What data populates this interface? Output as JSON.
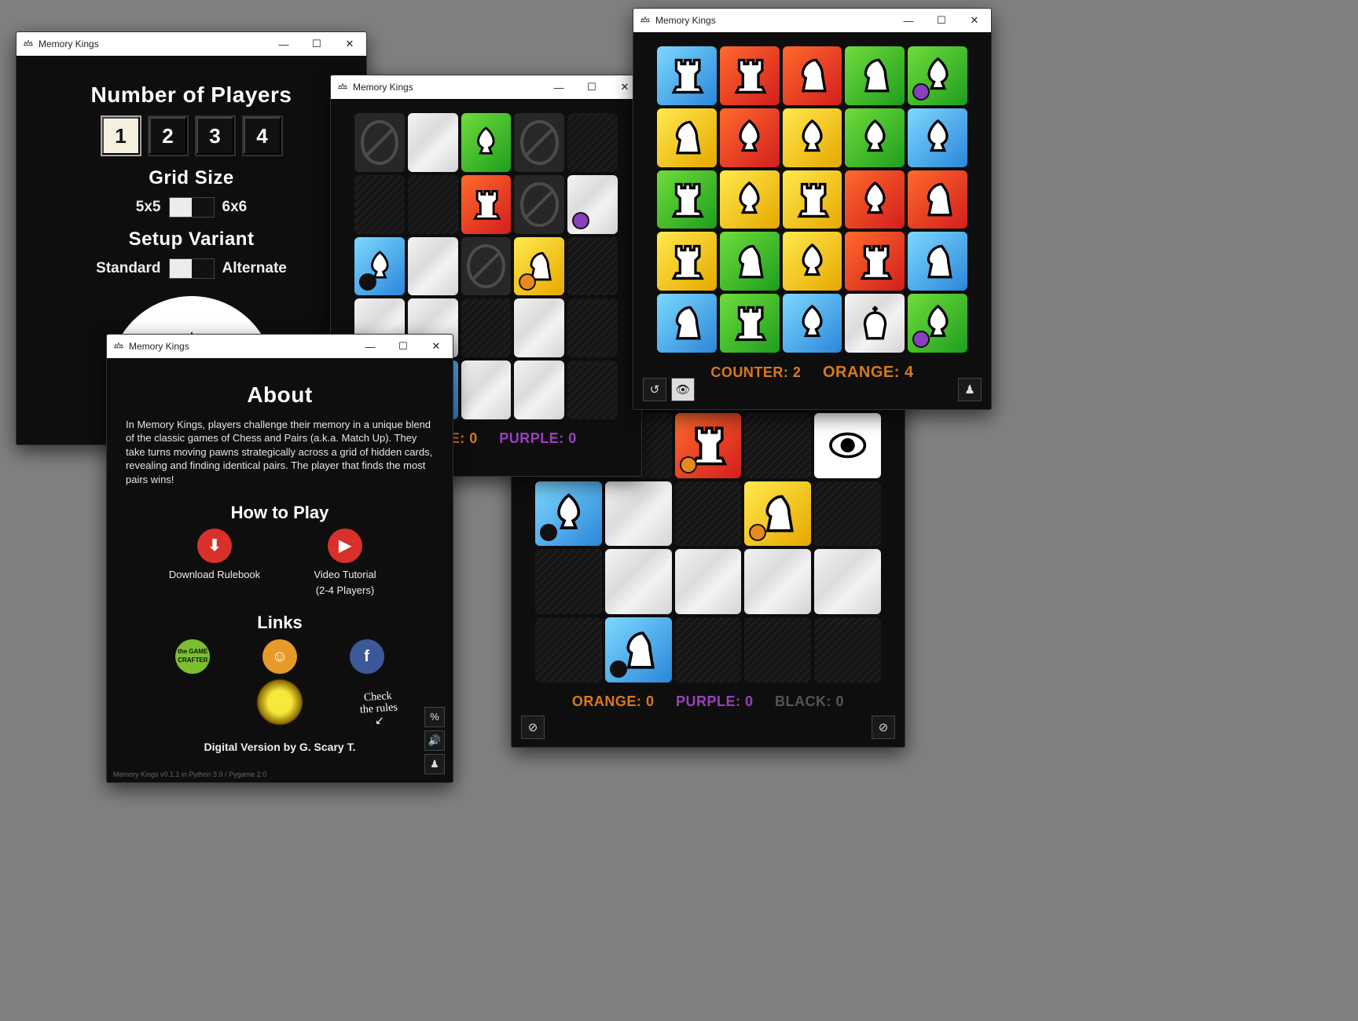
{
  "app_title": "Memory Kings",
  "settings": {
    "heading_players": "Number of Players",
    "players": [
      "1",
      "2",
      "3",
      "4"
    ],
    "selected_player": "1",
    "heading_grid": "Grid Size",
    "grid_left": "5x5",
    "grid_right": "6x6",
    "heading_variant": "Setup Variant",
    "variant_left": "Standard",
    "variant_right": "Alternate"
  },
  "about": {
    "title": "About",
    "text": "In Memory Kings, players challenge their memory in a unique blend of the classic games of Chess and Pairs (a.k.a. Match Up). They take turns moving pawns strategically across a grid of hidden cards, revealing and finding identical pairs. The player that finds the most pairs wins!",
    "howto": "How to Play",
    "download": "Download Rulebook",
    "video_line1": "Video Tutorial",
    "video_line2": "(2-4 Players)",
    "links": "Links",
    "credits": "Digital Version by G. Scary T.",
    "hand1": "Check",
    "hand2": "the rules",
    "footer": "Memory Kings v0.1.1 in Python 3.9 / Pygame 2.0"
  },
  "game1": {
    "score_orange_label": "ORANGE:",
    "score_orange_val": "0",
    "score_purple_label": "PURPLE:",
    "score_purple_val": "0",
    "cells": [
      "forbid",
      "marble",
      "green-bishop",
      "forbid",
      "black",
      "black",
      "black",
      "red-rook",
      "forbid",
      "marble-p",
      "blue-bishop-p",
      "marble",
      "forbid",
      "yellow-knight-p",
      "black",
      "marble",
      "marble",
      "black",
      "marble",
      "black",
      "forbid",
      "blue-knight-p",
      "marble",
      "marble",
      "black"
    ]
  },
  "game2": {
    "score_orange_label": "ORANGE:",
    "score_orange_val": "0",
    "score_purple_label": "PURPLE:",
    "score_purple_val": "0",
    "score_black_label": "BLACK:",
    "score_black_val": "0",
    "cells": [
      "black",
      "black",
      "black",
      "black",
      "black",
      "black",
      "black",
      "red-rook-p",
      "black",
      "eye",
      "blue-bishop-p",
      "marble",
      "black",
      "yellow-knight-p",
      "black",
      "black",
      "marble",
      "marble",
      "marble",
      "marble",
      "black",
      "blue-knight-p",
      "black",
      "black",
      "black"
    ]
  },
  "game3": {
    "counter_label": "COUNTER:",
    "counter_val": "2",
    "score_orange_label": "ORANGE:",
    "score_orange_val": "4",
    "cells": [
      "blue-rook",
      "red-rook",
      "red-knight",
      "green-knight",
      "green-bishop-p",
      "yellow-knight",
      "red-bishop",
      "yellow-bishop",
      "green-bishop",
      "blue-bishop",
      "green-rook",
      "yellow-bishop",
      "yellow-rook",
      "red-bishop",
      "red-knight",
      "yellow-rook",
      "green-knight",
      "yellow-bishop",
      "red-rook",
      "blue-knight",
      "blue-knight",
      "green-rook",
      "blue-bishop",
      "w-king",
      "green-bishop-p"
    ]
  }
}
